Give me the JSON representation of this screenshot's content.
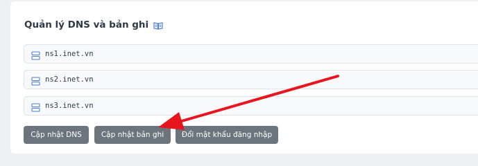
{
  "panel": {
    "title": "Quản lý DNS và bản ghi",
    "title_icon": "book-icon"
  },
  "nameservers": [
    {
      "value": "ns1.inet.vn",
      "icon": "server-icon"
    },
    {
      "value": "ns2.inet.vn",
      "icon": "server-icon"
    },
    {
      "value": "ns3.inet.vn",
      "icon": "server-icon"
    }
  ],
  "actions": {
    "update_dns": "Cập nhật DNS",
    "update_records": "Cập nhật bản ghi",
    "change_password": "Đổi mật khẩu đăng nhập"
  },
  "annotation": {
    "arrow_color": "#e8141e",
    "points_to": "Cập nhật bản ghi"
  },
  "colors": {
    "button_bg": "#6c757d",
    "icon_blue": "#4a7fd6"
  }
}
